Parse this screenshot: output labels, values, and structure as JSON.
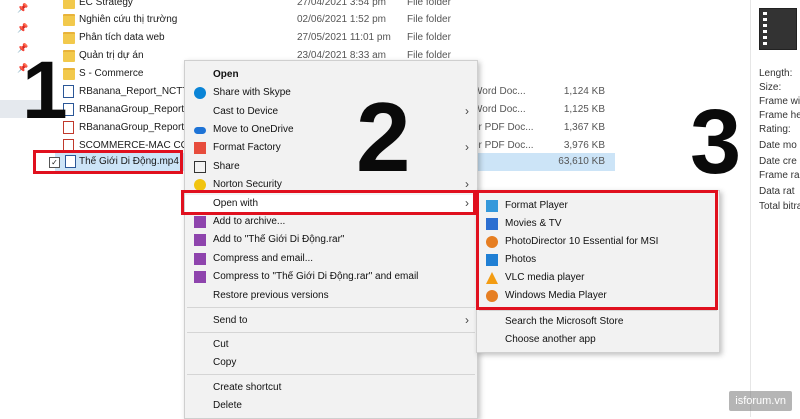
{
  "files": [
    {
      "name": "EC Strategy",
      "date": "27/04/2021 3:54 pm",
      "type": "File folder",
      "size": "",
      "kind": "folder"
    },
    {
      "name": "Nghiên cứu thị trường",
      "date": "02/06/2021 1:52 pm",
      "type": "File folder",
      "size": "",
      "kind": "folder"
    },
    {
      "name": "Phân tích data web",
      "date": "27/05/2021 11:01 pm",
      "type": "File folder",
      "size": "",
      "kind": "folder"
    },
    {
      "name": "Quản trị dự án",
      "date": "23/04/2021 8:33 am",
      "type": "File folder",
      "size": "",
      "kind": "folder"
    },
    {
      "name": "S - Commerce",
      "date": "",
      "type": "",
      "size": "",
      "kind": "folder"
    },
    {
      "name": "RBanana_Report_NCTTT",
      "date": "",
      "type": "Word Doc...",
      "size": "1,124 KB",
      "kind": "doc"
    },
    {
      "name": "RBananaGroup_Report_I",
      "date": "",
      "type": "Word Doc...",
      "size": "1,125 KB",
      "kind": "doc"
    },
    {
      "name": "RBananaGroup_Report_I",
      "date": "",
      "type": "er PDF Doc...",
      "size": "1,367 KB",
      "kind": "pdf"
    },
    {
      "name": "SCOMMERCE-MAC COI",
      "date": "",
      "type": "er PDF Doc...",
      "size": "3,976 KB",
      "kind": "pdf"
    },
    {
      "name": "Thế Giới Di Động.mp4",
      "date": "",
      "type": "",
      "size": "63,610 KB",
      "kind": "video"
    }
  ],
  "details": {
    "props": [
      "Length:",
      "Size:",
      "Frame wi",
      "Frame he",
      "Rating:",
      "Date mo",
      "Date cre",
      "Frame ra",
      "Data rat",
      "Total bitra"
    ]
  },
  "context_menu": {
    "items": [
      "Open",
      "Share with Skype",
      "Cast to Device",
      "Move to OneDrive",
      "Format Factory",
      "Share",
      "Norton Security",
      "Open with",
      "Add to archive...",
      "Add to \"Thế Giới Di Động.rar\"",
      "Compress and email...",
      "Compress to \"Thế Giới Di Động.rar\" and email",
      "Restore previous versions",
      "Send to",
      "Cut",
      "Copy",
      "Create shortcut",
      "Delete"
    ]
  },
  "open_with_menu": {
    "items": [
      "Format Player",
      "Movies & TV",
      "PhotoDirector 10 Essential for MSI",
      "Photos",
      "VLC media player",
      "Windows Media Player",
      "Search the Microsoft Store",
      "Choose another app"
    ]
  },
  "callouts": {
    "step1": "1",
    "step2": "2",
    "step3": "3"
  },
  "watermark": "isforum.vn",
  "colors": {
    "highlight_red": "#e0101e",
    "selection_blue": "#cce4f7",
    "menu_bg": "#f2f2f2"
  }
}
